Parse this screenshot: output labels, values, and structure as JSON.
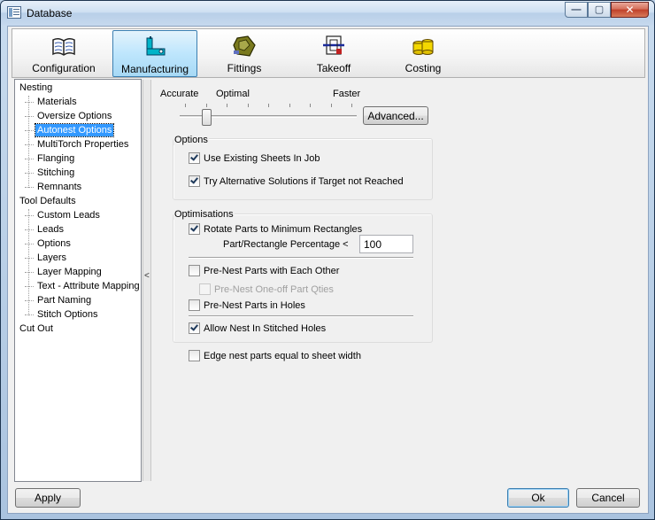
{
  "window": {
    "title": "Database"
  },
  "caption": {
    "minimize": "—",
    "maximize": "▢",
    "close": "✕"
  },
  "toolbar": {
    "items": [
      {
        "label": "Configuration",
        "icon": "book-icon"
      },
      {
        "label": "Manufacturing",
        "icon": "machine-icon"
      },
      {
        "label": "Fittings",
        "icon": "fitting-icon"
      },
      {
        "label": "Takeoff",
        "icon": "takeoff-icon"
      },
      {
        "label": "Costing",
        "icon": "coins-icon"
      }
    ],
    "active": "Manufacturing"
  },
  "tree": {
    "items": [
      {
        "label": "Nesting",
        "level": 0
      },
      {
        "label": "Materials",
        "level": 1
      },
      {
        "label": "Oversize Options",
        "level": 1
      },
      {
        "label": "Autonest Options",
        "level": 1,
        "selected": true
      },
      {
        "label": "MultiTorch Properties",
        "level": 1
      },
      {
        "label": "Flanging",
        "level": 1
      },
      {
        "label": "Stitching",
        "level": 1
      },
      {
        "label": "Remnants",
        "level": 1
      },
      {
        "label": "Tool Defaults",
        "level": 0
      },
      {
        "label": "Custom Leads",
        "level": 1
      },
      {
        "label": "Leads",
        "level": 1
      },
      {
        "label": "Options",
        "level": 1
      },
      {
        "label": "Layers",
        "level": 1
      },
      {
        "label": "Layer Mapping",
        "level": 1
      },
      {
        "label": "Text - Attribute Mapping",
        "level": 1
      },
      {
        "label": "Part Naming",
        "level": 1
      },
      {
        "label": "Stitch Options",
        "level": 1
      },
      {
        "label": "Cut Out",
        "level": 0
      }
    ]
  },
  "splitter": {
    "arrow": "<"
  },
  "slider": {
    "label_accurate": "Accurate",
    "label_optimal": "Optimal",
    "label_faster": "Faster",
    "ticks": 9,
    "position": 1
  },
  "advanced_button": "Advanced...",
  "options_group": {
    "title": "Options",
    "use_existing": {
      "label": "Use Existing Sheets In Job",
      "checked": true
    },
    "try_alternative": {
      "label": "Try Alternative Solutions if Target not Reached",
      "checked": true
    }
  },
  "optimisations_group": {
    "title": "Optimisations",
    "rotate_parts": {
      "label": "Rotate Parts to Minimum Rectangles",
      "checked": true
    },
    "percentage_label": "Part/Rectangle Percentage <",
    "percentage_value": "100",
    "pre_nest_each_other": {
      "label": "Pre-Nest Parts with Each Other",
      "checked": false
    },
    "pre_nest_one_off": {
      "label": "Pre-Nest One-off Part Qties",
      "checked": false,
      "disabled": true
    },
    "pre_nest_holes": {
      "label": "Pre-Nest Parts in Holes",
      "checked": false
    },
    "allow_stitched": {
      "label": "Allow Nest In Stitched Holes",
      "checked": true
    }
  },
  "edge_nest": {
    "label": "Edge nest parts equal to sheet width",
    "checked": false
  },
  "footer": {
    "apply": "Apply",
    "ok": "Ok",
    "cancel": "Cancel"
  }
}
